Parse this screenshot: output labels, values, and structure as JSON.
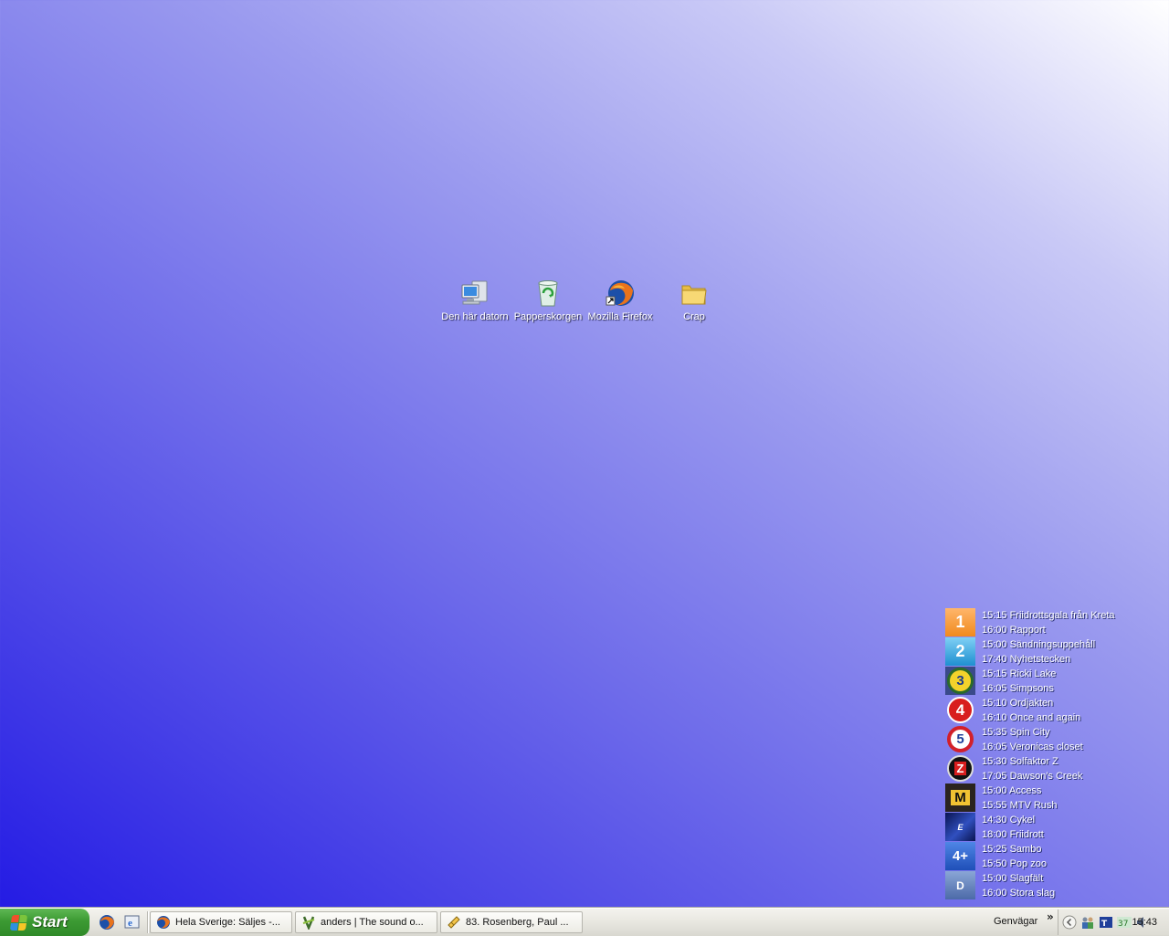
{
  "desktop": {
    "icons": [
      {
        "label": "Den här datorn",
        "icon": "my-computer-icon"
      },
      {
        "label": "Papperskorgen",
        "icon": "recycle-bin-icon"
      },
      {
        "label": "Mozilla Firefox",
        "icon": "firefox-icon"
      },
      {
        "label": "Crap",
        "icon": "folder-icon"
      }
    ]
  },
  "tv_guide": {
    "channels": [
      {
        "logo": "1",
        "icon": "svt1-logo",
        "line1": "15:15 Friidrottsgala från Kreta",
        "line2": "16:00 Rapport"
      },
      {
        "logo": "2",
        "icon": "svt2-logo",
        "line1": "15:00 Sändningsuppehåll",
        "line2": "17:40 Nyhetstecken"
      },
      {
        "logo": "3",
        "icon": "tv3-logo",
        "line1": "15:15 Ricki Lake",
        "line2": "16:05 Simpsons"
      },
      {
        "logo": "4",
        "icon": "tv4-logo",
        "line1": "15:10 Ordjakten",
        "line2": "16:10 Once and again"
      },
      {
        "logo": "5",
        "icon": "kanal5-logo",
        "line1": "15:35 Spin City",
        "line2": "16:05 Veronicas closet"
      },
      {
        "logo": "Z",
        "icon": "ztv-logo",
        "line1": "15:30 Solfaktor Z",
        "line2": "17:05 Dawson's Creek"
      },
      {
        "logo": "M",
        "icon": "mtv-logo",
        "line1": "15:00 Access",
        "line2": "15:55 MTV Rush"
      },
      {
        "logo": "E",
        "icon": "eurosport-logo",
        "line1": "14:30 Cykel",
        "line2": "18:00 Friidrott"
      },
      {
        "logo": "4+",
        "icon": "tv4plus-logo",
        "line1": "15:25 Sambo",
        "line2": "15:50 Pop zoo"
      },
      {
        "logo": "D",
        "icon": "discovery-logo",
        "line1": "15:00 Slagfält",
        "line2": "16:00 Stora slag"
      }
    ]
  },
  "taskbar": {
    "start_label": "Start",
    "tasks": [
      {
        "label": "Hela Sverige: Säljes -...",
        "icon": "firefox-icon"
      },
      {
        "label": "anders | The sound o...",
        "icon": "winamp-icon"
      },
      {
        "label": "83. Rosenberg, Paul ...",
        "icon": "media-player-icon"
      }
    ],
    "toolbar_label": "Genvägar",
    "chevron": "»",
    "clock": "15:43",
    "temp": "37"
  }
}
